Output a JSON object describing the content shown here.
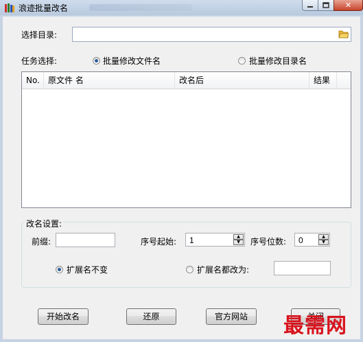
{
  "window": {
    "title": "浪迹批量改名",
    "close_glyph": "✕"
  },
  "directory": {
    "label": "选择目录:",
    "value": "",
    "placeholder": ""
  },
  "task": {
    "label": "任务选择:",
    "options": [
      {
        "label": "批量修改文件名",
        "selected": true
      },
      {
        "label": "批量修改目录名",
        "selected": false
      }
    ]
  },
  "table": {
    "columns": [
      "No.",
      "原文件 名",
      "改名后",
      "结果"
    ],
    "rows": []
  },
  "settings": {
    "group_label": "改名设置:",
    "prefix_label": "前缀:",
    "prefix_value": "",
    "start_label": "序号起始:",
    "start_value": "1",
    "digits_label": "序号位数:",
    "digits_value": "0",
    "ext_keep_label": "扩展名不变",
    "ext_keep_selected": true,
    "ext_change_label": "扩展名都改为:",
    "ext_change_selected": false,
    "ext_change_value": ""
  },
  "buttons": {
    "start": "开始改名",
    "restore": "还原",
    "website": "官方网站",
    "close": "关闭"
  },
  "watermark": "最需网",
  "colors": {
    "titlebar": "#c6d3e3",
    "close_button": "#c7432b",
    "watermark": "#d8131d",
    "radio_dot": "#2c5d9a"
  },
  "icons": [
    "app-icon",
    "folder-icon",
    "minimize-icon",
    "maximize-icon",
    "close-icon",
    "spin-up-icon",
    "spin-down-icon"
  ]
}
